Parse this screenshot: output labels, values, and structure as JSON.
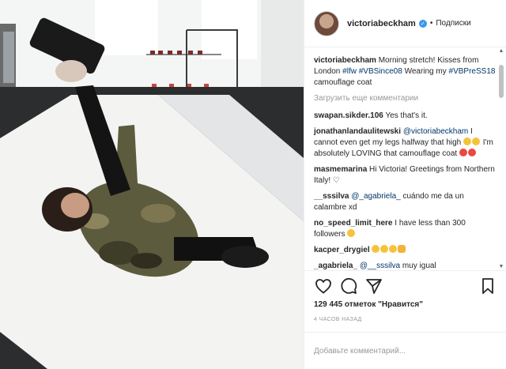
{
  "post": {
    "username": "victoriabeckham",
    "follow_label": "Подписки",
    "dot": "•",
    "caption": {
      "user": "victoriabeckham",
      "text": "Morning stretch! Kisses from London",
      "tags": [
        "#lfw",
        "#VBSince08"
      ],
      "middle": "Wearing my",
      "tag3": "#VBPreSS18",
      "end": "camouflage coat"
    },
    "load_more": "Загрузить еще комментарии",
    "comments": [
      {
        "user": "swapan.sikder.106",
        "text": "Yes that's it."
      },
      {
        "user": "jonathanlandaulitewski",
        "mention": "@victoriabeckham",
        "text": "I cannot even get my legs halfway that high",
        "text2": "I'm absolutely LOVING that camouflage coat"
      },
      {
        "user": "masmemarina",
        "text": "Hi Victoria! Greetings from Northern Italy! ♡"
      },
      {
        "user": "__sssilva",
        "mention": "@_agabriela_",
        "text": "cuándo me da un calambre xd"
      },
      {
        "user": "no_speed_limit_here",
        "text": "I have less than 300 followers"
      },
      {
        "user": "kacper_drygiel",
        "text": ""
      },
      {
        "user": "_agabriela_",
        "mention": "@__sssilva",
        "text": "muy igual"
      }
    ],
    "likes": "129 445 отметок \"Нравится\"",
    "time": "4 ЧАСОВ НАЗАД",
    "add_comment_placeholder": "Добавьте комментарий..."
  },
  "icons": {
    "like": "heart-icon",
    "comment": "comment-icon",
    "share": "share-icon",
    "save": "bookmark-icon"
  }
}
